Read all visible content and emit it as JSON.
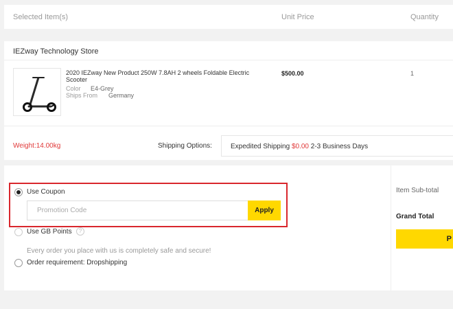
{
  "header": {
    "col_items": "Selected Item(s)",
    "col_unit_price": "Unit Price",
    "col_quantity": "Quantity"
  },
  "store": {
    "name": "IEZway Technology Store"
  },
  "product": {
    "name": "2020 IEZway New Product 250W 7.8AH 2 wheels Foldable Electric Scooter",
    "color_label": "Color",
    "color_value": "E4-Grey",
    "ships_from_label": "Ships From",
    "ships_from_value": "Germany",
    "price": "$500.00",
    "quantity": "1"
  },
  "shipping": {
    "weight": "Weight:14.00kg",
    "options_label": "Shipping Options:",
    "method": "Expedited Shipping",
    "cost": "$0.00",
    "duration": "2-3 Business Days"
  },
  "payment_options": {
    "coupon_label": "Use Coupon",
    "promo_placeholder": "Promotion Code",
    "apply_label": "Apply",
    "gb_points_label": "Use GB Points",
    "help_glyph": "?",
    "safe_message": "Every order you place with us is completely safe and secure!",
    "dropshipping_label": "Order requirement: Dropshipping"
  },
  "summary": {
    "subtotal_label": "Item Sub-total",
    "grand_total_label": "Grand Total",
    "checkout_label": "P"
  },
  "colors": {
    "accent_yellow": "#ffd800",
    "highlight_red": "#d9262c",
    "price_red": "#e03838"
  }
}
